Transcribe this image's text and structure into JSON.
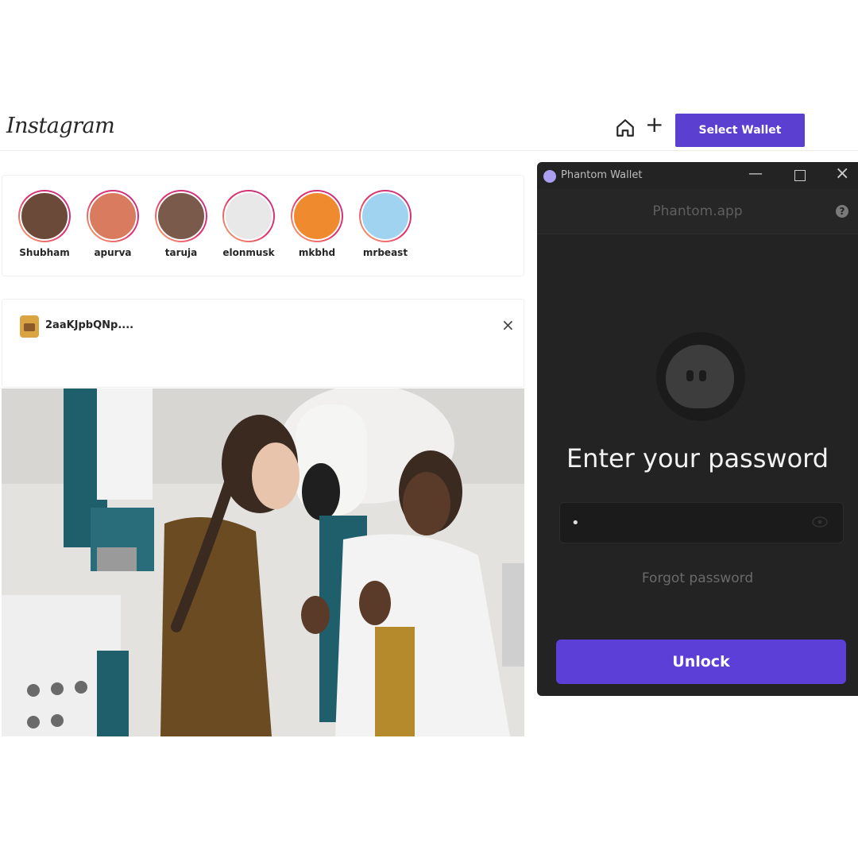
{
  "header": {
    "logo_text": "Instagram",
    "select_wallet_label": "Select Wallet",
    "icons": [
      "home-icon",
      "plus-icon"
    ]
  },
  "stories": [
    {
      "name": "Shubham",
      "color": "#6b4a3a"
    },
    {
      "name": "apurva",
      "color": "#d97b5e"
    },
    {
      "name": "taruja",
      "color": "#7a5a4a"
    },
    {
      "name": "elonmusk",
      "color": "#e8e8e8"
    },
    {
      "name": "mkbhd",
      "color": "#f08a2e"
    },
    {
      "name": "mrbeast",
      "color": "#9fd3f0"
    }
  ],
  "post": {
    "username": "2aaKJpbQNp....",
    "close_label": "×"
  },
  "wallet": {
    "window_title": "Phantom Wallet",
    "host": "Phantom.app",
    "heading": "Enter your password",
    "password_value": "•",
    "forgot_label": "Forgot password",
    "unlock_label": "Unlock",
    "accent": "#5b3fd6"
  }
}
